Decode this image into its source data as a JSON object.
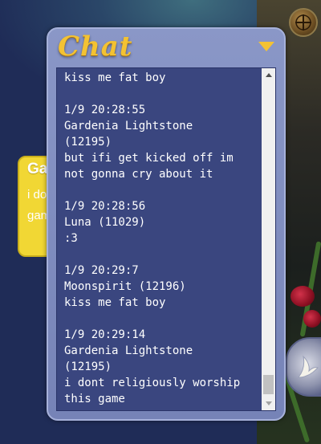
{
  "chat": {
    "title": "Chat",
    "lines": [
      "kiss me fat boy",
      "",
      "1/9 20:28:55",
      "Gardenia Lightstone",
      "(12195)",
      "but ifi get kicked off im",
      "not gonna cry about it",
      "",
      "1/9 20:28:56",
      "Luna (11029)",
      ":3",
      "",
      "1/9 20:29:7",
      "Moonspirit (12196)",
      "kiss me fat boy",
      "",
      "1/9 20:29:14",
      "Gardenia Lightstone",
      "(12195)",
      "i dont religiously worship",
      "this game"
    ]
  },
  "yellow_card": {
    "name_partial": "Ga",
    "line1": "i do",
    "line2": "gam"
  },
  "icons": {
    "compass": "compass-icon",
    "toggle": "triangle-down-icon",
    "round_button": "bird-icon"
  },
  "colors": {
    "chat_title": "#f3c233",
    "chat_panel": "#7f8cc0",
    "chat_body": "#3a467f",
    "yellow_card": "#f1d734"
  }
}
